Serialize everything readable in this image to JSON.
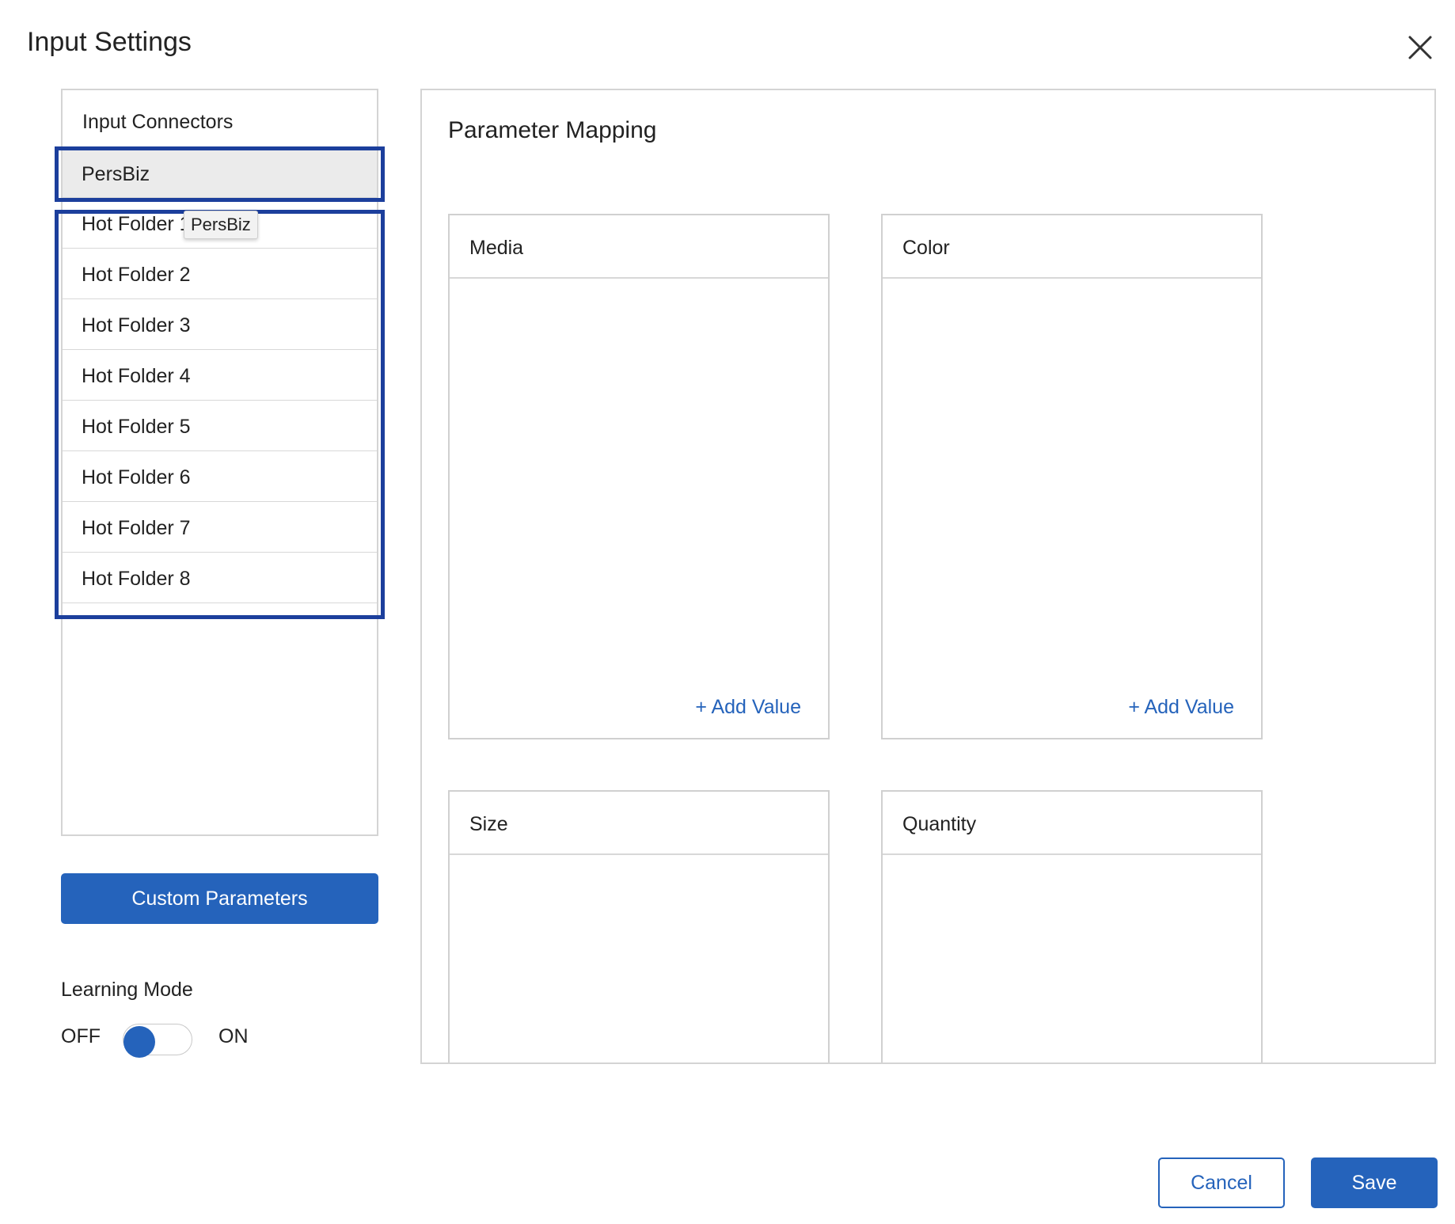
{
  "dialog": {
    "title": "Input Settings",
    "close_icon": "close-icon"
  },
  "connectors": {
    "header": "Input Connectors",
    "selected": "PersBiz",
    "items": [
      "Hot Folder 1",
      "Hot Folder 2",
      "Hot Folder 3",
      "Hot Folder 4",
      "Hot Folder 5",
      "Hot Folder 6",
      "Hot Folder 7",
      "Hot Folder 8"
    ],
    "tooltip": "PersBiz"
  },
  "custom_parameters_label": "Custom Parameters",
  "learning_mode": {
    "label": "Learning Mode",
    "off_label": "OFF",
    "on_label": "ON",
    "state": "off"
  },
  "mapping": {
    "title": "Parameter Mapping",
    "cards": [
      {
        "title": "Media",
        "action": "+ Add Value"
      },
      {
        "title": "Color",
        "action": "+ Add Value"
      },
      {
        "title": "Size"
      },
      {
        "title": "Quantity"
      }
    ]
  },
  "footer": {
    "cancel_label": "Cancel",
    "save_label": "Save"
  },
  "colors": {
    "accent": "#2563bb",
    "selection_outline": "#1c3f9c",
    "selected_row": "#ebebeb"
  }
}
